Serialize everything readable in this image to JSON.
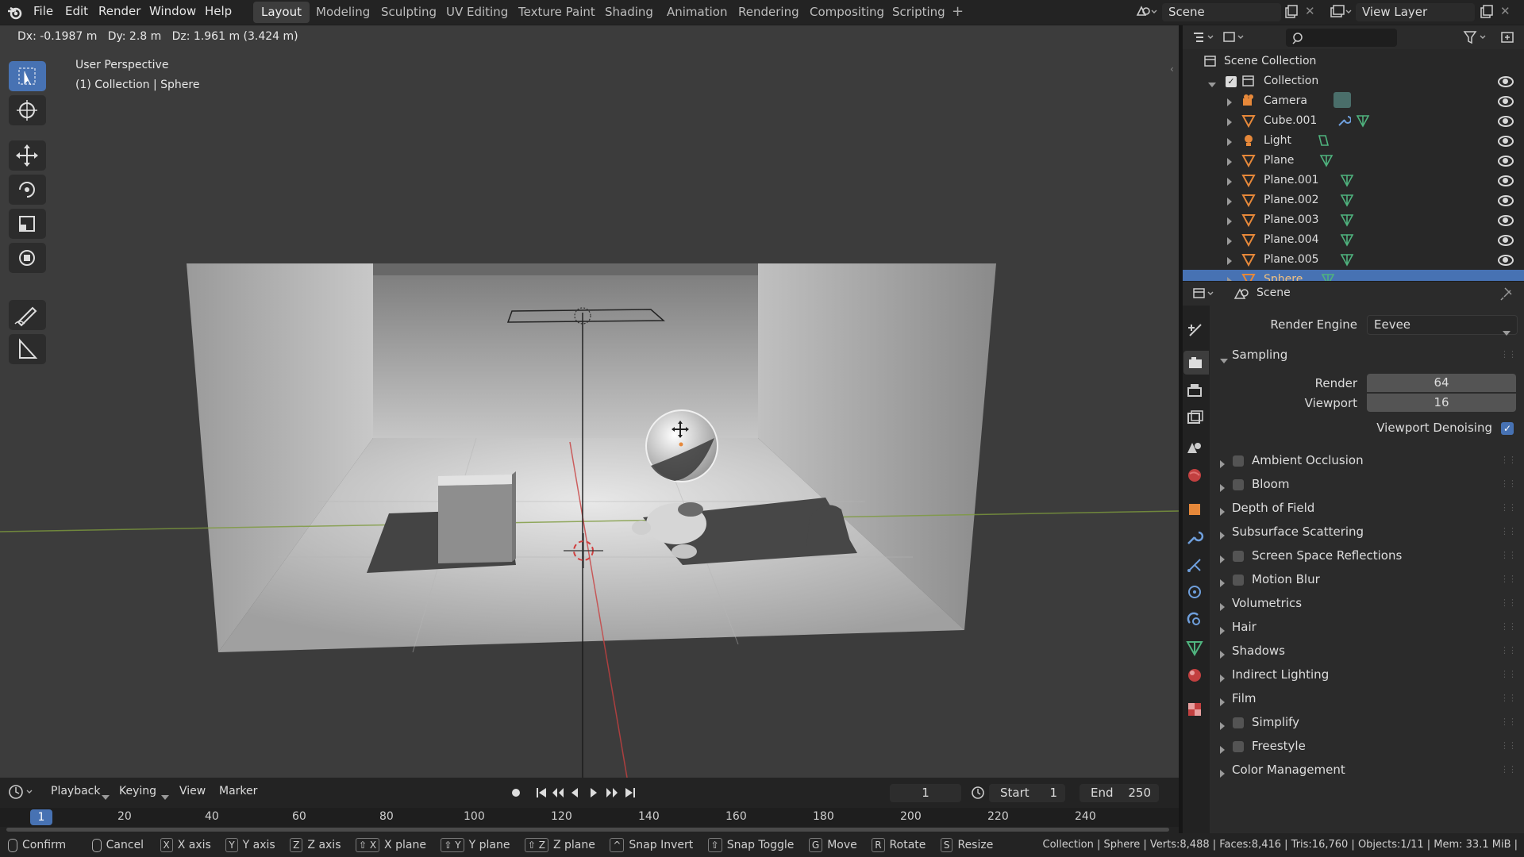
{
  "topbar": {
    "menus": [
      "File",
      "Edit",
      "Render",
      "Window",
      "Help"
    ],
    "workspaces": [
      "Layout",
      "Modeling",
      "Sculpting",
      "UV Editing",
      "Texture Paint",
      "Shading",
      "Animation",
      "Rendering",
      "Compositing",
      "Scripting"
    ],
    "add_tab": "+",
    "scene_label": "Scene",
    "view_layer_label": "View Layer"
  },
  "viewport": {
    "transform_readout": "Dx: -0.1987 m   Dy: 2.8 m   Dz: 1.961 m (3.424 m)",
    "perspective": "User Perspective",
    "context": "(1) Collection | Sphere"
  },
  "timeline": {
    "menus": [
      "Playback",
      "Keying",
      "View",
      "Marker"
    ],
    "current_frame": "1",
    "start_label": "Start",
    "start_value": "1",
    "end_label": "End",
    "end_value": "250",
    "ruler": [
      "1",
      "20",
      "40",
      "60",
      "80",
      "100",
      "120",
      "140",
      "160",
      "180",
      "200",
      "220",
      "240"
    ]
  },
  "outliner": {
    "root": "Scene Collection",
    "collection": "Collection",
    "items": [
      {
        "name": "Camera",
        "icon": "camera-icon"
      },
      {
        "name": "Cube.001",
        "icon": "mesh-icon"
      },
      {
        "name": "Light",
        "icon": "light-icon"
      },
      {
        "name": "Plane",
        "icon": "mesh-icon"
      },
      {
        "name": "Plane.001",
        "icon": "mesh-icon"
      },
      {
        "name": "Plane.002",
        "icon": "mesh-icon"
      },
      {
        "name": "Plane.003",
        "icon": "mesh-icon"
      },
      {
        "name": "Plane.004",
        "icon": "mesh-icon"
      },
      {
        "name": "Plane.005",
        "icon": "mesh-icon"
      },
      {
        "name": "Sphere",
        "icon": "mesh-icon"
      }
    ]
  },
  "properties": {
    "context": "Scene",
    "render_engine_label": "Render Engine",
    "render_engine_value": "Eevee",
    "sampling_label": "Sampling",
    "render_label": "Render",
    "render_value": "64",
    "viewport_label": "Viewport",
    "viewport_value": "16",
    "denoise_label": "Viewport Denoising",
    "denoise_checked": true,
    "sections": [
      {
        "label": "Ambient Occlusion",
        "checkbox": true
      },
      {
        "label": "Bloom",
        "checkbox": true
      },
      {
        "label": "Depth of Field",
        "checkbox": false
      },
      {
        "label": "Subsurface Scattering",
        "checkbox": false
      },
      {
        "label": "Screen Space Reflections",
        "checkbox": true
      },
      {
        "label": "Motion Blur",
        "checkbox": true
      },
      {
        "label": "Volumetrics",
        "checkbox": false
      },
      {
        "label": "Hair",
        "checkbox": false
      },
      {
        "label": "Shadows",
        "checkbox": false
      },
      {
        "label": "Indirect Lighting",
        "checkbox": false
      },
      {
        "label": "Film",
        "checkbox": false
      },
      {
        "label": "Simplify",
        "checkbox": true
      },
      {
        "label": "Freestyle",
        "checkbox": true
      },
      {
        "label": "Color Management",
        "checkbox": false
      }
    ]
  },
  "status": {
    "hints": [
      {
        "key": "",
        "label": "Confirm"
      },
      {
        "key": "",
        "label": "Cancel"
      },
      {
        "key": "X",
        "label": "X axis"
      },
      {
        "key": "Y",
        "label": "Y axis"
      },
      {
        "key": "Z",
        "label": "Z axis"
      },
      {
        "key": "⇧ X",
        "label": "X plane"
      },
      {
        "key": "⇧ Y",
        "label": "Y plane"
      },
      {
        "key": "⇧ Z",
        "label": "Z plane"
      },
      {
        "key": "^",
        "label": "Snap Invert"
      },
      {
        "key": "⇧",
        "label": "Snap Toggle"
      },
      {
        "key": "G",
        "label": "Move"
      },
      {
        "key": "R",
        "label": "Rotate"
      },
      {
        "key": "S",
        "label": "Resize"
      }
    ],
    "stats": "Collection | Sphere | Verts:8,488 | Faces:8,416 | Tris:16,760 | Objects:1/11 | Mem: 33.1 MiB |"
  },
  "colors": {
    "accent": "#4772b3",
    "object_orange": "#e6883a",
    "mesh_green": "#4fb37e"
  }
}
